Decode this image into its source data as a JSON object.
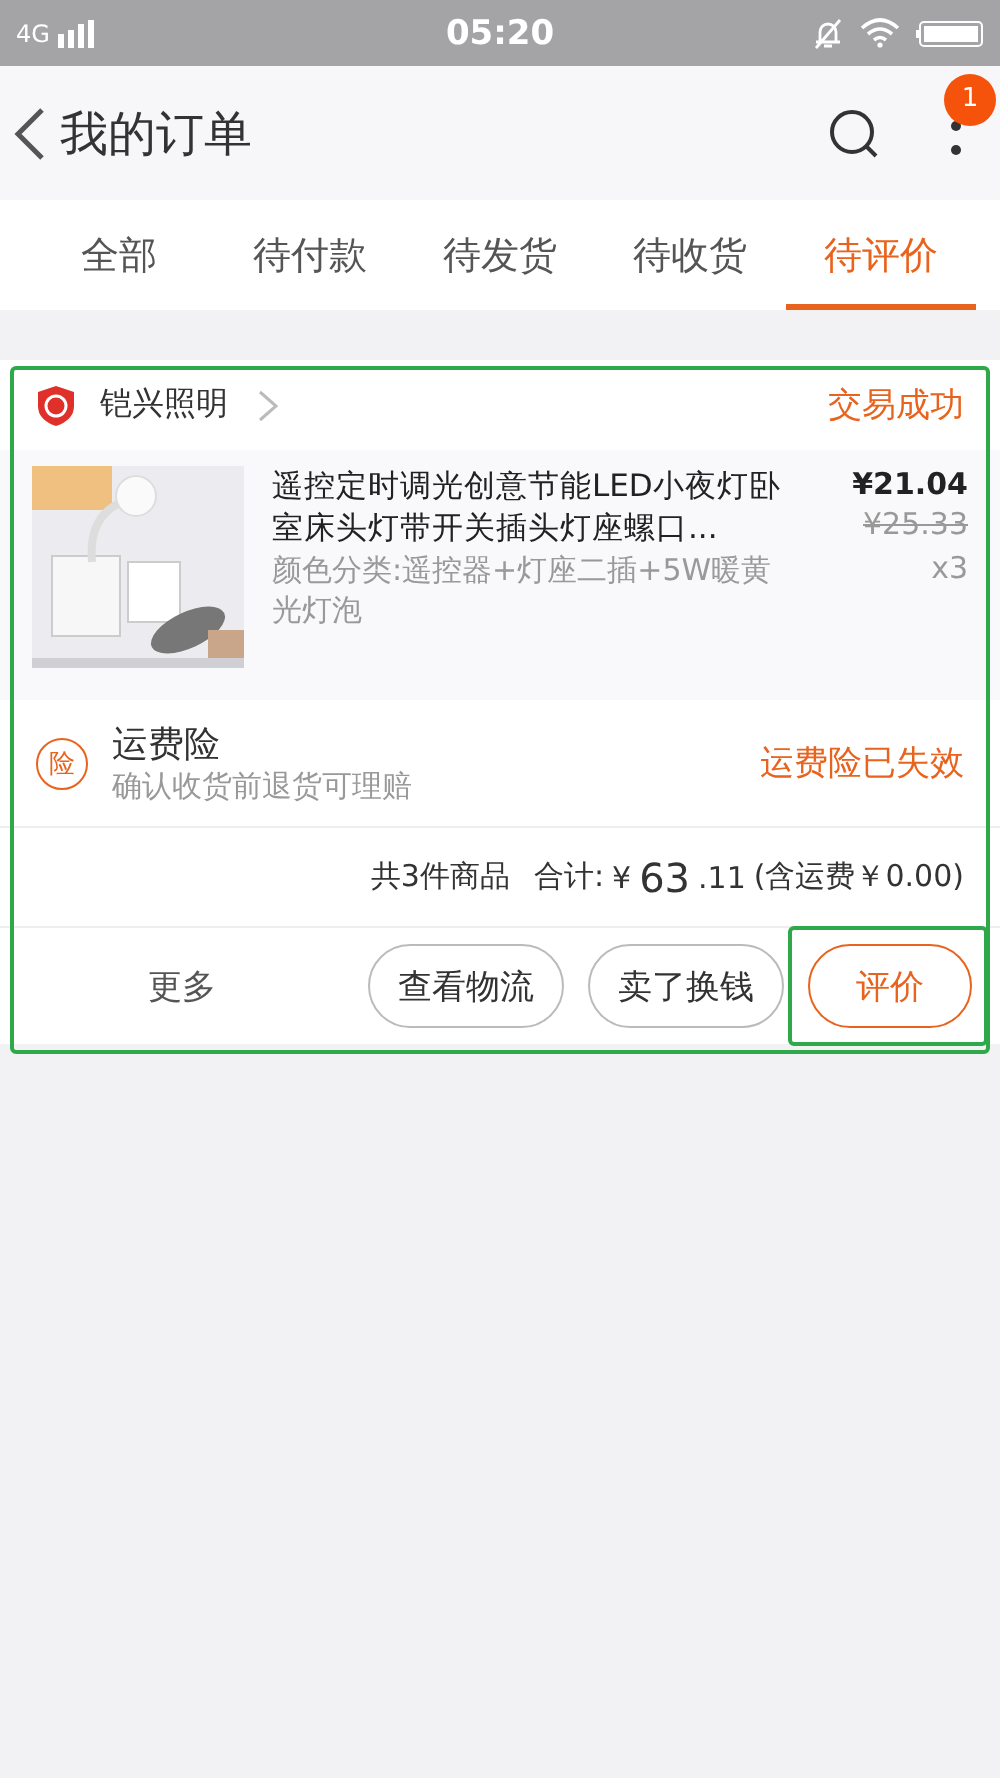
{
  "status_bar": {
    "network": "4G",
    "time": "05:20"
  },
  "header": {
    "title": "我的订单",
    "badge": "1"
  },
  "tabs": [
    {
      "label": "全部",
      "selected": false
    },
    {
      "label": "待付款",
      "selected": false
    },
    {
      "label": "待发货",
      "selected": false
    },
    {
      "label": "待收货",
      "selected": false
    },
    {
      "label": "待评价",
      "selected": true
    }
  ],
  "order": {
    "highlighted": true,
    "shop": "铠兴照明",
    "status": "交易成功",
    "product": {
      "title": "遥控定时调光创意节能LED小夜灯卧室床头灯带开关插头灯座螺口...",
      "variant": "颜色分类:遥控器+灯座二插+5W暖黄光灯泡",
      "price": "¥21.04",
      "original_price": "¥25.33",
      "quantity": "x3"
    },
    "insurance": {
      "icon": "险",
      "title": "运费险",
      "subtitle": "确认收货前退货可理赔",
      "status": "运费险已失效"
    },
    "summary": {
      "count": "共3件商品",
      "label": "合计:",
      "currency": "¥",
      "integer": "63",
      "decimal": ".11",
      "shipping": "(含运费￥0.00)"
    },
    "more": "更多",
    "buttons": [
      {
        "label": "查看物流",
        "primary": false,
        "highlighted": false
      },
      {
        "label": "卖了换钱",
        "primary": false,
        "highlighted": false
      },
      {
        "label": "评价",
        "primary": true,
        "highlighted": true
      }
    ]
  }
}
